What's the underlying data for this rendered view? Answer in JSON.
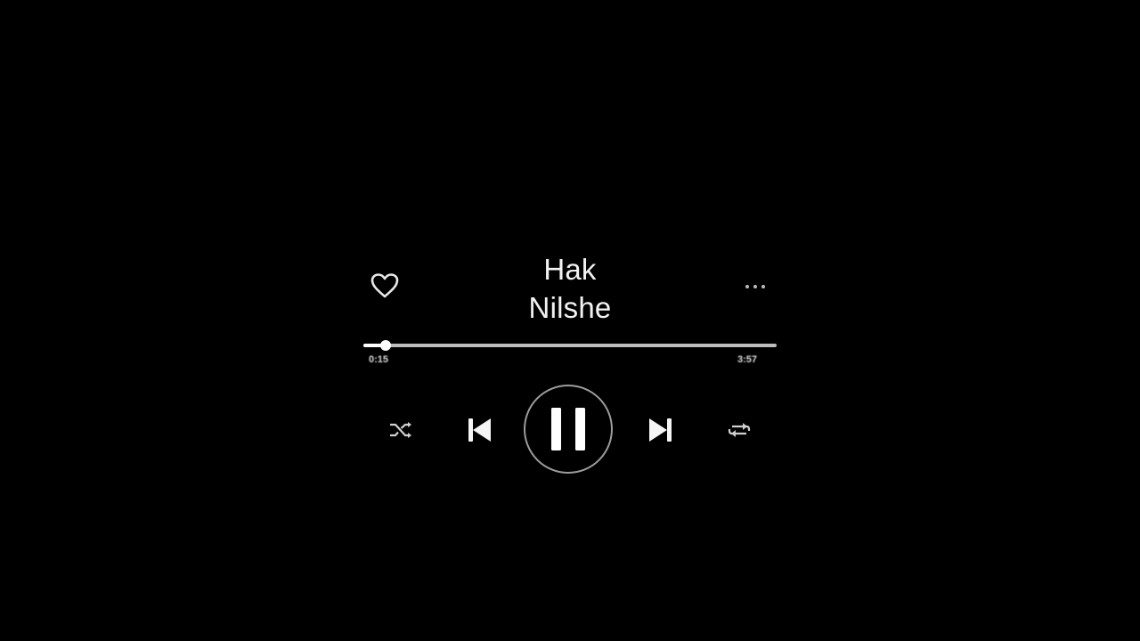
{
  "track": {
    "title": "Hak",
    "artist": "Nilshe"
  },
  "progress": {
    "elapsed": "0:15",
    "total": "3:57",
    "fraction": 0.054
  },
  "controls": {
    "like_icon": "heart-icon",
    "more_icon": "ellipsis-icon",
    "shuffle_icon": "shuffle-icon",
    "previous_icon": "skip-previous-icon",
    "play_pause_icon": "pause-icon",
    "next_icon": "skip-next-icon",
    "repeat_icon": "repeat-icon"
  },
  "colors": {
    "background": "#000000",
    "foreground": "#ffffff",
    "track": "#bdbdbd",
    "ring": "#9c9c9c"
  }
}
